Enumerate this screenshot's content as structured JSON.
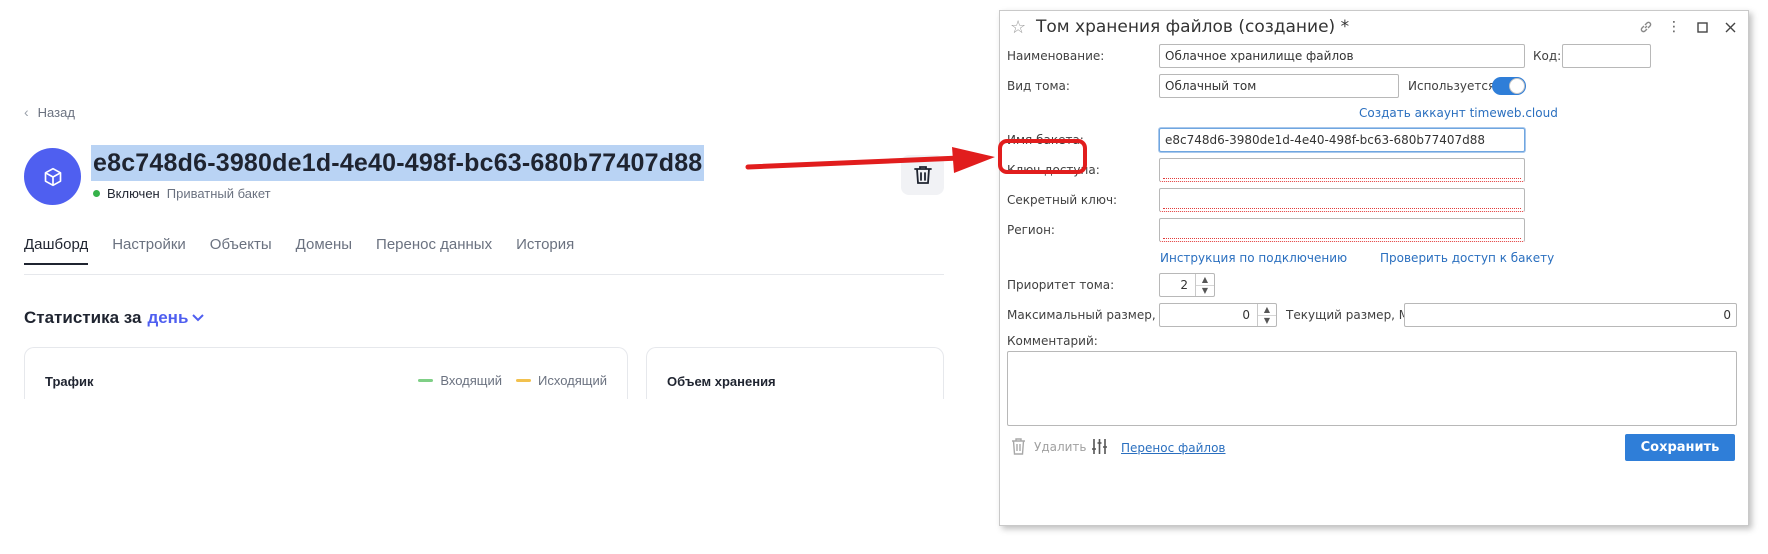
{
  "left": {
    "back_label": "Назад",
    "bucket_name": "e8c748d6-3980de1d-4e40-498f-bc63-680b77407d88",
    "status": "Включен",
    "bucket_type": "Приватный бакет",
    "tabs": [
      {
        "label": "Дашборд",
        "active": true
      },
      {
        "label": "Настройки",
        "active": false
      },
      {
        "label": "Объекты",
        "active": false
      },
      {
        "label": "Домены",
        "active": false
      },
      {
        "label": "Перенос данных",
        "active": false
      },
      {
        "label": "История",
        "active": false
      }
    ],
    "stats_title": "Статистика за",
    "stats_period": "день",
    "traffic_card": {
      "title": "Трафик",
      "legend": [
        {
          "label": "Входящий",
          "color": "#7fcf86"
        },
        {
          "label": "Исходящий",
          "color": "#f2c14e"
        }
      ]
    },
    "storage_card": {
      "title": "Объем хранения"
    },
    "colors": {
      "accent": "#4f5ff0",
      "status_on": "#36b24a",
      "selection": "#b9d3f4"
    }
  },
  "arrow": {
    "color": "#e11d1d"
  },
  "dialog": {
    "title": "Том хранения файлов (создание) *",
    "fields": {
      "name_label": "Наименование:",
      "name_value": "Облачное хранилище файлов",
      "code_label": "Код:",
      "code_value": "",
      "volume_type_label": "Вид тома:",
      "volume_type_value": "Облачный том",
      "used_label": "Используется:",
      "used_on": true,
      "create_account_link": "Создать аккаунт timeweb.cloud",
      "bucket_label": "Имя бакета:",
      "bucket_value": "e8c748d6-3980de1d-4e40-498f-bc63-680b77407d88",
      "access_key_label": "Ключ доступа:",
      "access_key_value": "",
      "secret_key_label": "Секретный ключ:",
      "secret_key_value": "",
      "region_label": "Регион:",
      "region_value": "",
      "instruction_link": "Инструкция по подключению",
      "check_access_link": "Проверить доступ к бакету",
      "priority_label": "Приоритет тома:",
      "priority_value": "2",
      "max_size_label": "Максимальный размер, Мб:",
      "max_size_value": "0",
      "current_size_label": "Текущий размер, Мб:",
      "current_size_value": "0",
      "comment_label": "Комментарий:",
      "comment_value": ""
    },
    "footer": {
      "delete_label": "Удалить",
      "transfer_link": "Перенос файлов",
      "save_label": "Сохранить"
    },
    "colors": {
      "primary": "#2f7ed8",
      "link": "#2a6fbf",
      "required_underline": "#e23a3a",
      "highlight": "#e11d1d"
    }
  }
}
